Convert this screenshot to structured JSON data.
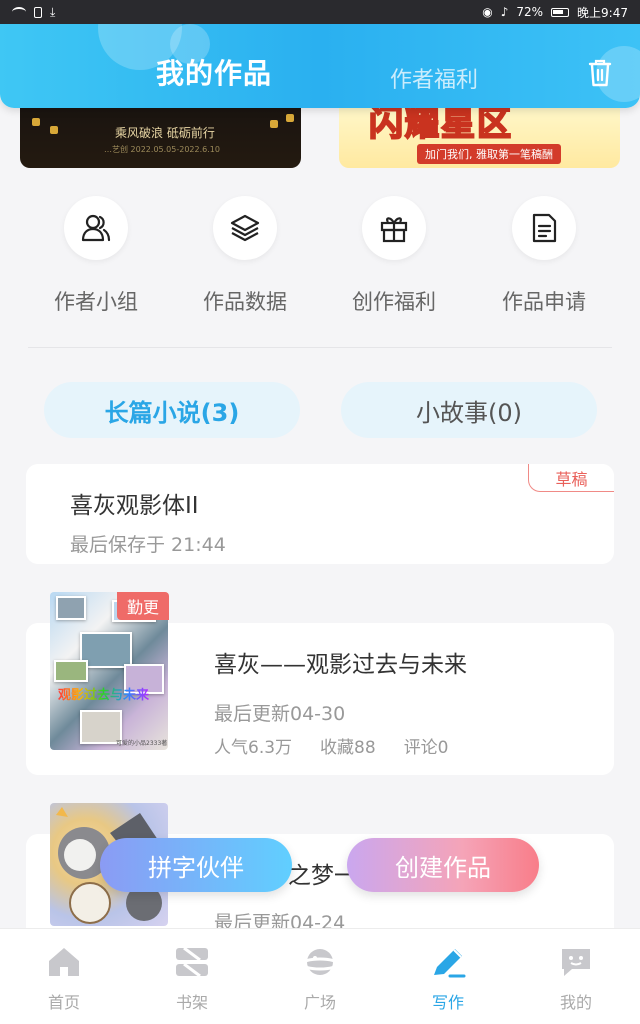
{
  "status_bar": {
    "battery": "72%",
    "time": "晚上9:47"
  },
  "header": {
    "tab_active": "我的作品",
    "tab_inactive": "作者福利"
  },
  "banners": {
    "left": {
      "line1": "乘风破浪 砥砺前行",
      "line2": "…艺创 2022.05.05-2022.6.10"
    },
    "right": {
      "big": "闪耀星区",
      "ribbon": "加门我们, 雅取第一笔稿酬"
    }
  },
  "quick_grid": [
    {
      "label": "作者小组",
      "icon": "people-icon"
    },
    {
      "label": "作品数据",
      "icon": "layers-icon"
    },
    {
      "label": "创作福利",
      "icon": "gift-icon"
    },
    {
      "label": "作品申请",
      "icon": "document-icon"
    }
  ],
  "segments": {
    "active": "长篇小说(3)",
    "inactive": "小故事(0)"
  },
  "draft": {
    "title": "喜灰观影体II",
    "subtitle": "最后保存于 21:44",
    "badge": "草稿"
  },
  "works": [
    {
      "title": "喜灰——观影过去与未来",
      "updated": "最后更新04-30",
      "popularity": "人气6.3万",
      "favorites": "收藏88",
      "comments": "评论0",
      "badge": "勤更",
      "cover_text": "观影过去与未来",
      "cover_credit": "可爱的小品2333著"
    },
    {
      "title_partial": "之梦一",
      "updated": "最后更新04-24"
    }
  ],
  "float_buttons": {
    "left": "拼字伙伴",
    "right": "创建作品"
  },
  "bottom_nav": [
    {
      "label": "首页",
      "icon": "home-icon",
      "active": false
    },
    {
      "label": "书架",
      "icon": "bookshelf-icon",
      "active": false
    },
    {
      "label": "广场",
      "icon": "planet-icon",
      "active": false
    },
    {
      "label": "写作",
      "icon": "pen-icon",
      "active": true
    },
    {
      "label": "我的",
      "icon": "chat-bubble-icon",
      "active": false
    }
  ],
  "colors": {
    "accent": "#2aa6e6",
    "header": "#38bdf4",
    "badge_red": "#ef6b68"
  }
}
